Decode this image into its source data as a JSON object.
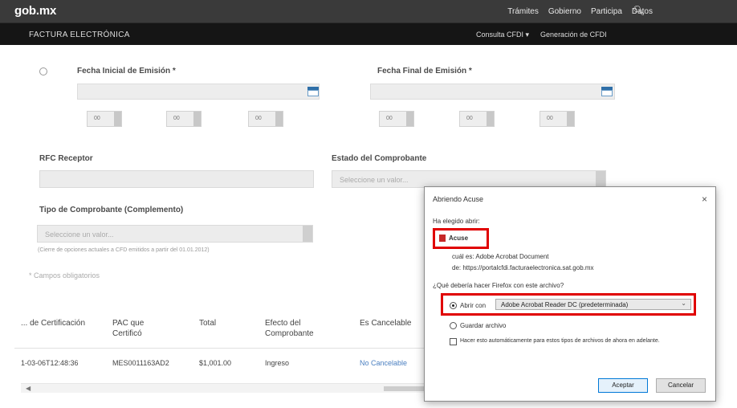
{
  "header": {
    "brand": "gob.mx",
    "nav": [
      "Trámites",
      "Gobierno",
      "Participa",
      "Datos"
    ],
    "search_icon": "search-icon"
  },
  "subheader": {
    "title": "FACTURA ELECTRÓNICA",
    "nav": [
      "Consulta CFDI ▾",
      "Generación de CFDI"
    ]
  },
  "form": {
    "fecha_inicial_label": "Fecha Inicial de Emisión *",
    "fecha_final_label": "Fecha Final de Emisión *",
    "time_defaults": [
      "00",
      "00",
      "00",
      "00",
      "00",
      "00"
    ],
    "rfc_receptor_label": "RFC Receptor",
    "estado_label": "Estado del Comprobante",
    "estado_placeholder": "Seleccione un valor...",
    "tipo_label": "Tipo de Comprobante (Complemento)",
    "tipo_placeholder": "Seleccione un valor...",
    "tipo_note": "(Cierre de opciones actuales a CFD emitidos a partir del 01.01.2012)",
    "campos_note": "* Campos obligatorios"
  },
  "table": {
    "headers": [
      "... de Certificación",
      "PAC que Certificó",
      "Total",
      "Efecto del Comprobante",
      "Es Cancelable"
    ],
    "row": [
      "1-03-06T12:48:36",
      "MES0011163AD2",
      "$1,001.00",
      "Ingreso",
      "No Cancelable"
    ]
  },
  "dialog": {
    "title": "Abriendo Acuse",
    "close": "×",
    "intro": "Ha elegido abrir:",
    "file_name": "Acuse",
    "file_type": "cuál es: Adobe Acrobat Document",
    "file_source": "de: https://portalcfdi.facturaelectronica.sat.gob.mx",
    "question": "¿Qué debería hacer Firefox con este archivo?",
    "open_with_label": "Abrir con",
    "open_with_app": "Adobe Acrobat Reader DC (predeterminada)",
    "save_label": "Guardar archivo",
    "remember_label": "Hacer esto automáticamente para estos tipos de archivos de ahora en adelante.",
    "ok_button": "Aceptar",
    "cancel_button": "Cancelar"
  },
  "colors": {
    "topbar": "#3a3a3a",
    "subbar": "#151515",
    "highlight": "#e00000",
    "link": "#4a7fc0",
    "calendar": "#2f6fa8"
  }
}
